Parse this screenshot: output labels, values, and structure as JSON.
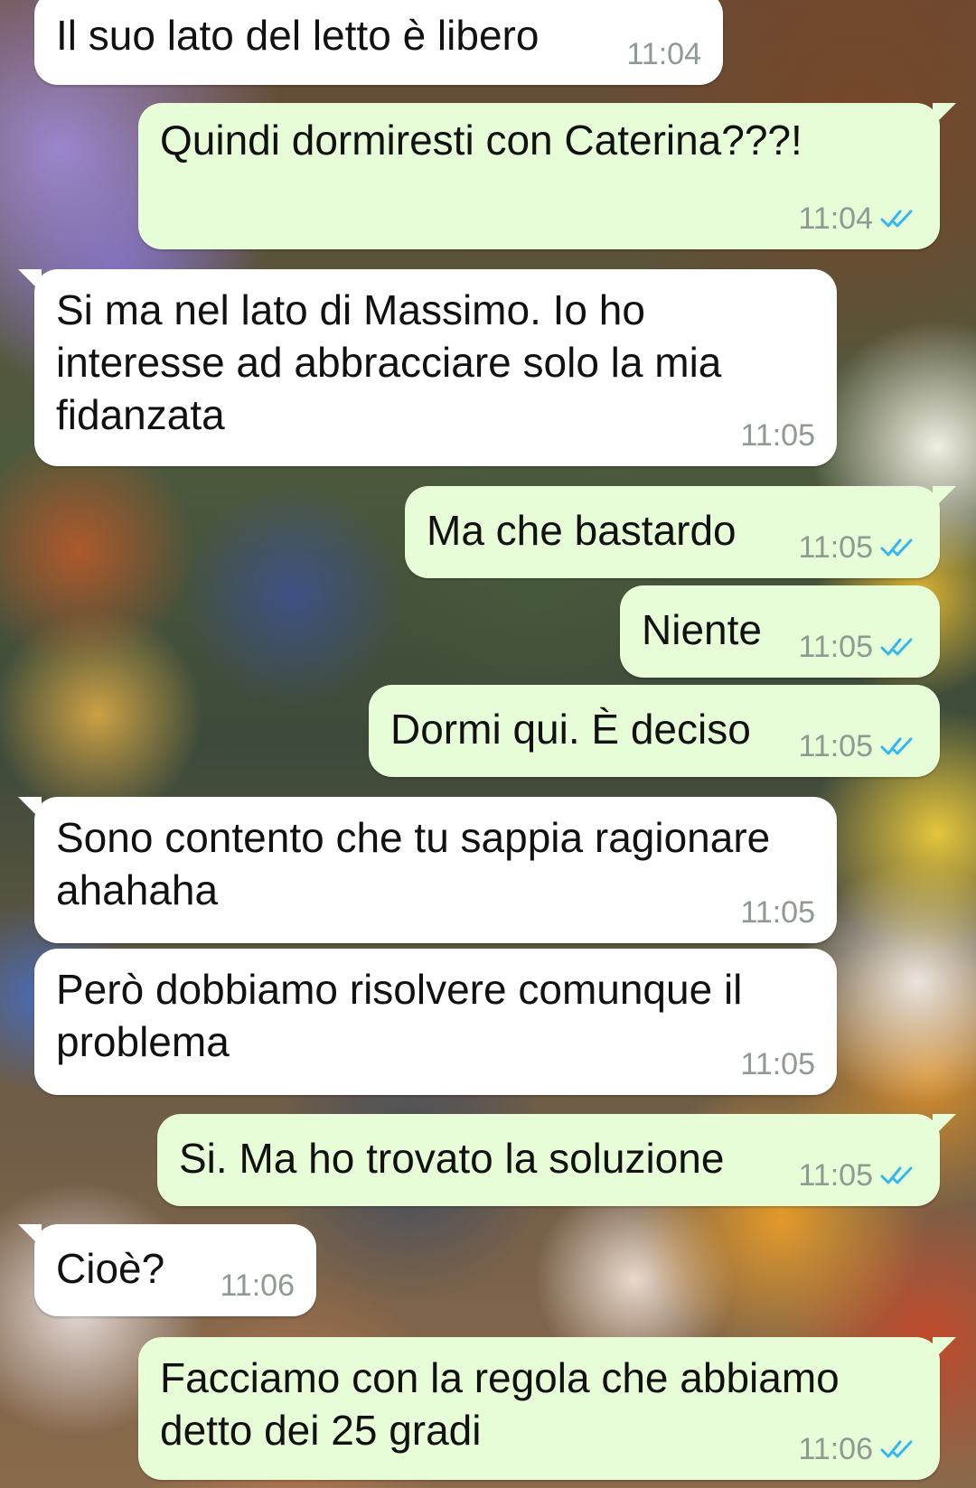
{
  "conversation": {
    "messages": [
      {
        "id": "m1",
        "direction": "in",
        "text": "Il suo lato del letto è libero",
        "time": "11:04"
      },
      {
        "id": "m2",
        "direction": "out",
        "text": "Quindi dormiresti con Caterina???!",
        "time": "11:04",
        "status": "read"
      },
      {
        "id": "m3",
        "direction": "in",
        "text": "Si ma nel lato di Massimo. Io ho interesse ad abbracciare solo la mia fidanzata",
        "time": "11:05"
      },
      {
        "id": "m4",
        "direction": "out",
        "text": "Ma che bastardo",
        "time": "11:05",
        "status": "read"
      },
      {
        "id": "m5",
        "direction": "out",
        "text": "Niente",
        "time": "11:05",
        "status": "read"
      },
      {
        "id": "m6",
        "direction": "out",
        "text": "Dormi qui. È deciso",
        "time": "11:05",
        "status": "read"
      },
      {
        "id": "m7",
        "direction": "in",
        "text": "Sono contento che tu sappia ragionare ahahaha",
        "time": "11:05"
      },
      {
        "id": "m8",
        "direction": "in",
        "text": "Però dobbiamo risolvere comunque il problema",
        "time": "11:05"
      },
      {
        "id": "m9",
        "direction": "out",
        "text": "Si. Ma ho trovato la soluzione",
        "time": "11:05",
        "status": "read"
      },
      {
        "id": "m10",
        "direction": "in",
        "text": "Cioè?",
        "time": "11:06"
      },
      {
        "id": "m11",
        "direction": "out",
        "text": "Facciamo con la regola che abbiamo detto dei 25 gradi",
        "time": "11:06",
        "status": "read"
      }
    ]
  },
  "colors": {
    "incoming_bubble": "#ffffff",
    "outgoing_bubble": "#e6fdd7",
    "timestamp": "#8e9a92",
    "read_ticks": "#34b7f1"
  },
  "icons": {
    "read_receipt": "double-check-icon"
  }
}
